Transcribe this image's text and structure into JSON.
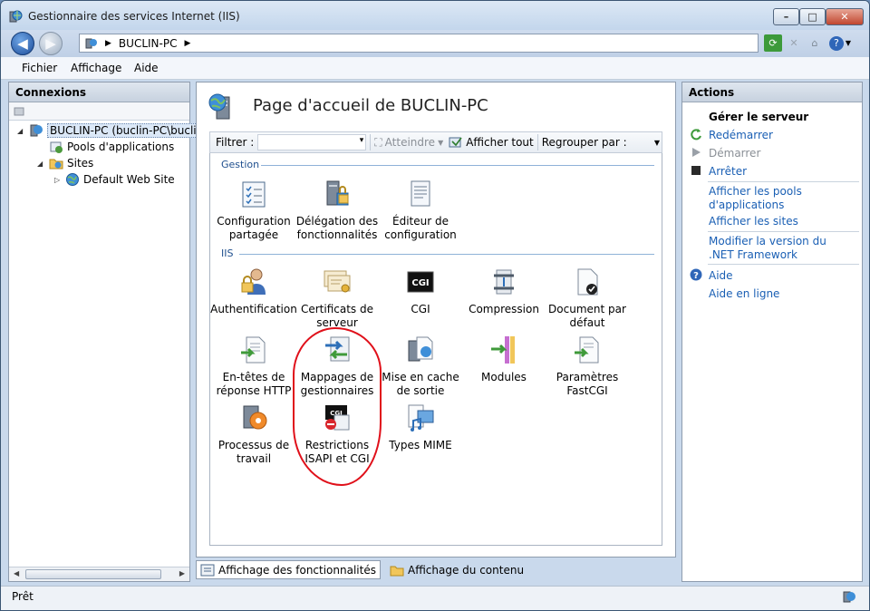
{
  "window": {
    "title": "Gestionnaire des services Internet (IIS)",
    "minimize": "–",
    "maximize": "□",
    "close": "✕"
  },
  "address": {
    "crumb": "BUCLIN-PC",
    "sep1": "▶",
    "sep2": "▶"
  },
  "menu": {
    "file": "Fichier",
    "view": "Affichage",
    "help": "Aide"
  },
  "connections": {
    "title": "Connexions",
    "tree": [
      {
        "label": "BUCLIN-PC (buclin-PC\\buclin)",
        "icon": "server-icon"
      },
      {
        "label": "Pools d'applications",
        "icon": "app-pools-icon"
      },
      {
        "label": "Sites",
        "icon": "sites-folder-icon"
      },
      {
        "label": "Default Web Site",
        "icon": "globe-icon"
      }
    ]
  },
  "main": {
    "title": "Page d'accueil de BUCLIN-PC",
    "filter_label": "Filtrer :",
    "goto_label": "Atteindre",
    "show_all_label": "Afficher tout",
    "group_by_label": "Regrouper par :",
    "groups": [
      {
        "name": "Gestion",
        "features": [
          {
            "label": "Configuration partagée",
            "icon": "shared-config-icon"
          },
          {
            "label": "Délégation des fonctionnalités",
            "icon": "feature-delegation-icon"
          },
          {
            "label": "Éditeur de configuration",
            "icon": "config-editor-icon"
          }
        ]
      },
      {
        "name": "IIS",
        "features": [
          {
            "label": "Authentification",
            "icon": "authentication-icon"
          },
          {
            "label": "Certificats de serveur",
            "icon": "server-certificates-icon"
          },
          {
            "label": "CGI",
            "icon": "cgi-icon"
          },
          {
            "label": "Compression",
            "icon": "compression-icon"
          },
          {
            "label": "Document par défaut",
            "icon": "default-document-icon"
          },
          {
            "label": "En-têtes de réponse HTTP",
            "icon": "http-headers-icon"
          },
          {
            "label": "Mappages de gestionnaires",
            "icon": "handler-mappings-icon"
          },
          {
            "label": "Mise en cache de sortie",
            "icon": "output-caching-icon"
          },
          {
            "label": "Modules",
            "icon": "modules-icon"
          },
          {
            "label": "Paramètres FastCGI",
            "icon": "fastcgi-settings-icon"
          },
          {
            "label": "Processus de travail",
            "icon": "worker-processes-icon"
          },
          {
            "label": "Restrictions ISAPI et CGI",
            "icon": "isapi-cgi-restrictions-icon"
          },
          {
            "label": "Types MIME",
            "icon": "mime-types-icon"
          }
        ]
      }
    ],
    "tab_features": "Affichage des fonctionnalités",
    "tab_content": "Affichage du contenu"
  },
  "actions": {
    "title": "Actions",
    "manage_server": "Gérer le serveur",
    "restart": "Redémarrer",
    "start": "Démarrer",
    "stop": "Arrêter",
    "view_app_pools": "Afficher les pools d'applications",
    "view_sites": "Afficher les sites",
    "change_net": "Modifier la version du .NET Framework",
    "help": "Aide",
    "online_help": "Aide en ligne"
  },
  "status": {
    "text": "Prêt"
  },
  "colors": {
    "link": "#1a5fb4",
    "annotation": "#e0101a",
    "group_label": "#1f4f8e"
  }
}
